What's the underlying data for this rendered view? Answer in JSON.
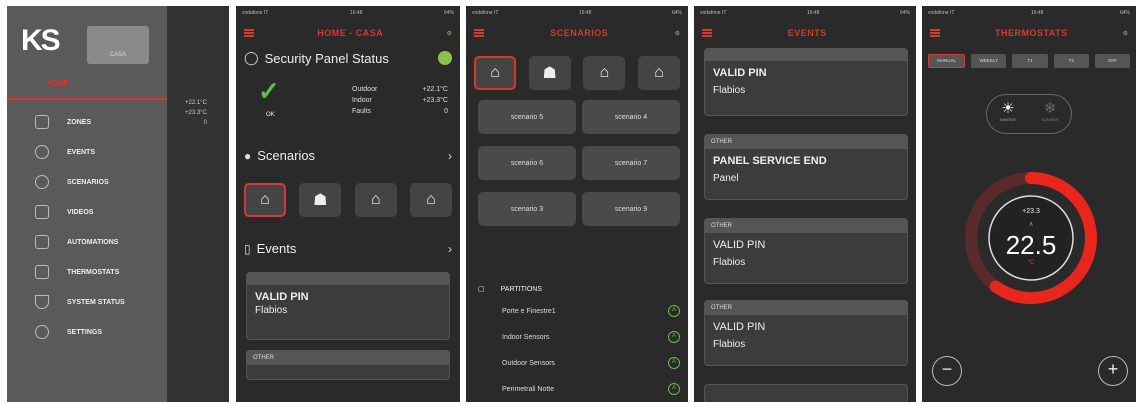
{
  "menu": {
    "logo": "KS",
    "user_button": "CASA",
    "home_label": "HOME",
    "items": [
      {
        "label": "ZONES",
        "icon": "zones-icon"
      },
      {
        "label": "EVENTS",
        "icon": "events-icon"
      },
      {
        "label": "SCENARIOS",
        "icon": "scenarios-icon"
      },
      {
        "label": "VIDEOS",
        "icon": "videos-icon"
      },
      {
        "label": "AUTOMATIONS",
        "icon": "automations-icon"
      },
      {
        "label": "THERMOSTATS",
        "icon": "thermostat-icon"
      },
      {
        "label": "SYSTEM STATUS",
        "icon": "shield-icon"
      },
      {
        "label": "SETTINGS",
        "icon": "gear-icon"
      }
    ],
    "behind_temps": [
      "+22.1°C",
      "+23.3°C",
      "0"
    ]
  },
  "screens": {
    "home": {
      "title": "HOME - CASA",
      "status": {
        "carrier": "vodafone IT",
        "time": "16:48",
        "battery": "64%"
      },
      "security_title": "Security Panel Status",
      "ok_label": "OK",
      "outdoor_label": "Outdoor",
      "outdoor_value": "+22.1°C",
      "indoor_label": "Indoor",
      "indoor_value": "+23.3°C",
      "faults_label": "Faults",
      "faults_value": "0",
      "scenarios_title": "Scenarios",
      "events_title": "Events",
      "event1": {
        "title": "VALID PIN",
        "subtitle": "Flabios"
      },
      "event2_head": "OTHER"
    },
    "scenarios": {
      "title": "SCENARIOS",
      "items": [
        "scenario 5",
        "scenario 4",
        "scenario 6",
        "scenario 7",
        "scenario 3",
        "scenario 9"
      ],
      "partitions_title": "PARTITIONS",
      "partitions": [
        "Porte e Finestre1",
        "Indoor Sensors",
        "Outdoor Sensors",
        "Perimetrali Notte"
      ]
    },
    "events": {
      "title": "EVENTS",
      "cards": [
        {
          "head": "",
          "title": "VALID PIN",
          "subtitle": "Flabios"
        },
        {
          "head": "OTHER",
          "title": "PANEL SERVICE END",
          "subtitle": "Panel"
        },
        {
          "head": "OTHER",
          "title": "VALID PIN",
          "subtitle": "Flabios"
        },
        {
          "head": "OTHER",
          "title": "VALID PIN",
          "subtitle": "Flabios"
        }
      ]
    },
    "thermostats": {
      "title": "THERMOSTATS",
      "modes": [
        "MANUAL",
        "WEEKLY",
        "T1",
        "T2",
        "OFF"
      ],
      "season_left": "WINTER",
      "season_right": "SUMMER",
      "measured": "+23.3",
      "setpoint": "22.5",
      "unit": "°C",
      "setpoint_level": 0.6
    }
  },
  "colors": {
    "accent": "#d3392f",
    "ok": "#5fbf4a",
    "bg": "#2a2a2a"
  }
}
